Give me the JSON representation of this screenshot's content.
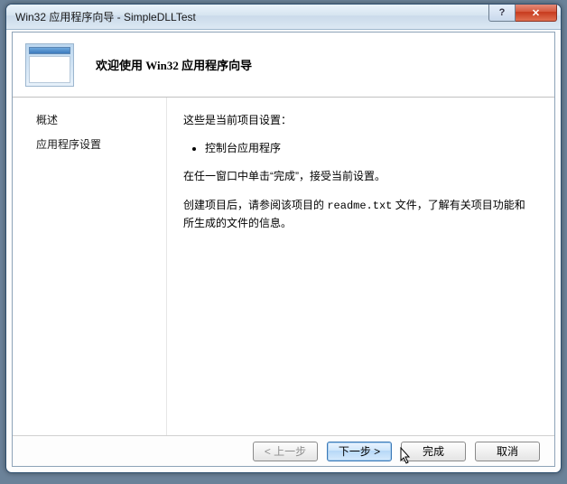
{
  "window": {
    "title": "Win32 应用程序向导 - SimpleDLLTest"
  },
  "header": {
    "heading": "欢迎使用 Win32 应用程序向导"
  },
  "sidebar": {
    "items": [
      {
        "label": "概述"
      },
      {
        "label": "应用程序设置"
      }
    ]
  },
  "content": {
    "intro": "这些是当前项目设置：",
    "bullets": [
      "控制台应用程序"
    ],
    "para1": "在任一窗口中单击“完成”，接受当前设置。",
    "para2_before": "创建项目后，请参阅该项目的 ",
    "readme": "readme.txt",
    "para2_after": " 文件，了解有关项目功能和所生成的文件的信息。"
  },
  "footer": {
    "back": "< 上一步",
    "next": "下一步 >",
    "finish": "完成",
    "cancel": "取消"
  }
}
